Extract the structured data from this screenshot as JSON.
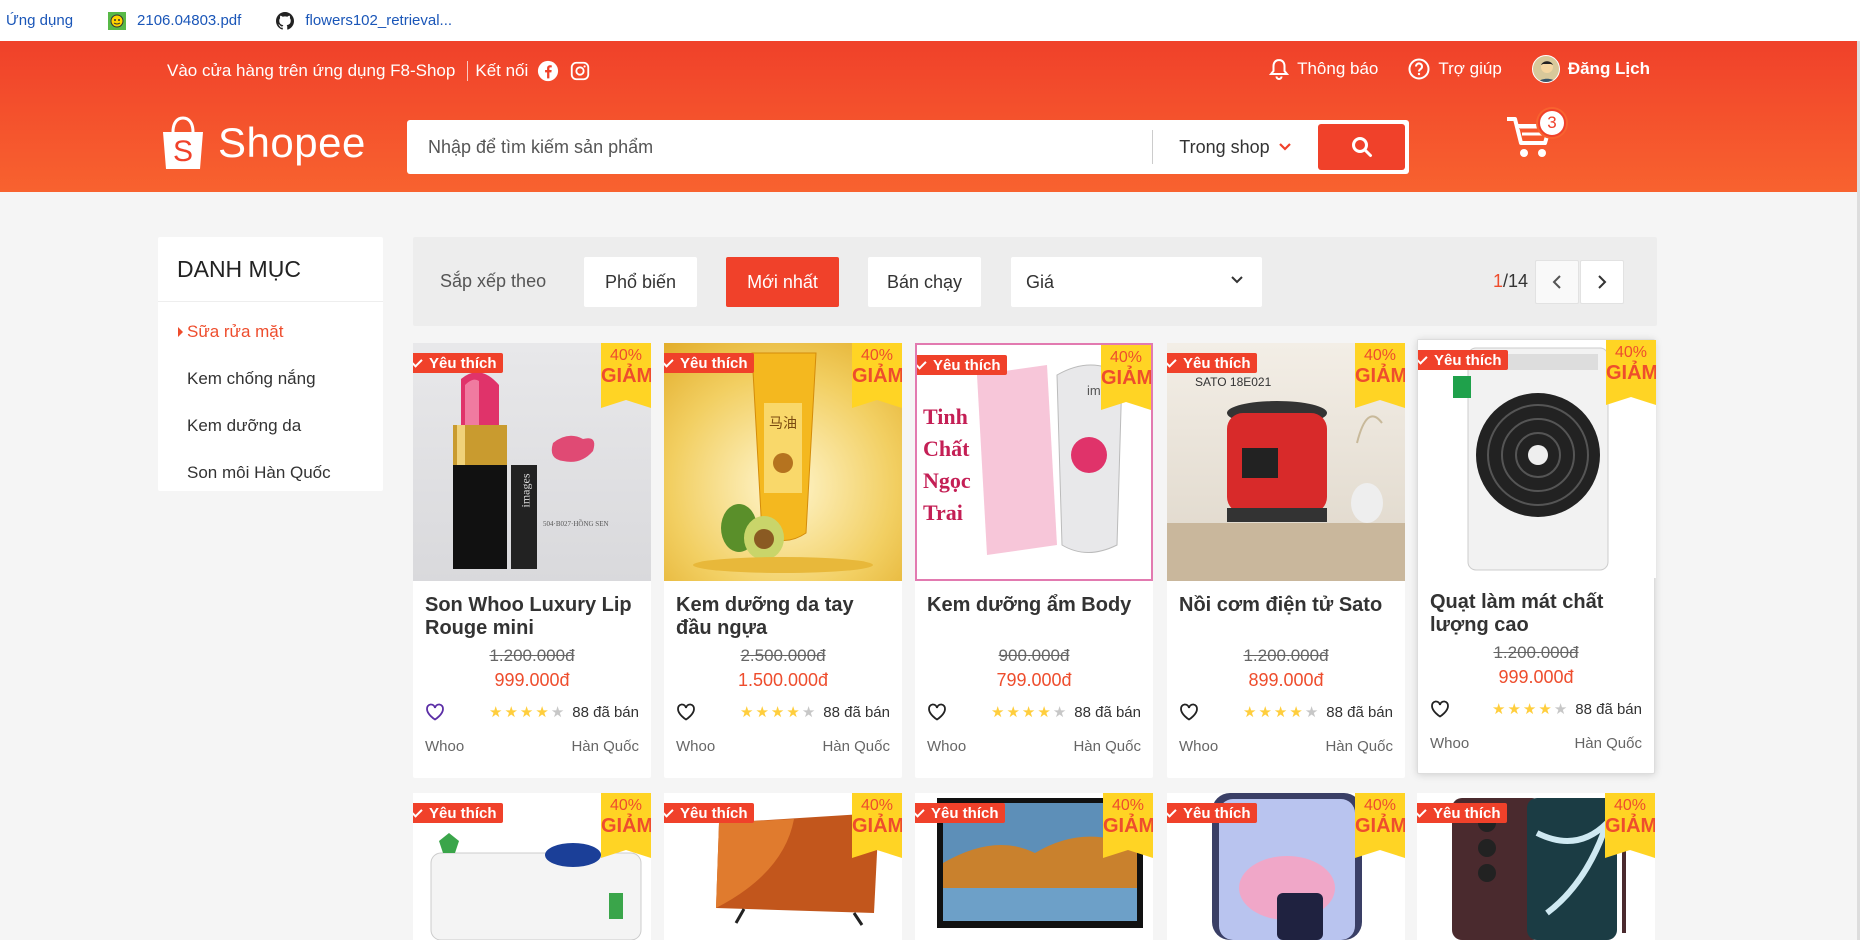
{
  "bookmarks": [
    {
      "label": "Ứng dụng",
      "icon": "apps-icon"
    },
    {
      "label": "2106.04803.pdf",
      "icon": "pdf-favicon-icon"
    },
    {
      "label": "flowers102_retrieval...",
      "icon": "github-icon"
    }
  ],
  "navbar": {
    "app_text": "Vào cửa hàng trên ứng dụng F8-Shop",
    "connect": "Kết nối",
    "notifications": "Thông báo",
    "help": "Trợ giúp",
    "user": "Đăng Lịch"
  },
  "logo": {
    "text": "Shopee"
  },
  "search": {
    "placeholder": "Nhập để tìm kiếm sản phẩm",
    "scope": "Trong shop"
  },
  "cart": {
    "count": "3"
  },
  "category": {
    "heading": "DANH MỤC",
    "items": [
      "Sữa rửa mặt",
      "Kem chống nắng",
      "Kem dưỡng da",
      "Son môi Hàn Quốc"
    ]
  },
  "filter": {
    "label": "Sắp xếp theo",
    "popular": "Phổ biến",
    "newest": "Mới nhất",
    "bestselling": "Bán chạy",
    "price": "Giá",
    "page_current": "1",
    "page_total": "/14"
  },
  "products": [
    {
      "name": "Son Whoo Luxury Lip Rouge mini",
      "old_price": "1.200.000đ",
      "new_price": "999.000đ",
      "rating": 4,
      "sold": "88 đã bán",
      "brand": "Whoo",
      "origin": "Hàn Quốc",
      "badge": "Yêu thích",
      "sale_pct": "40%",
      "sale_label": "GIẢM",
      "liked": true
    },
    {
      "name": "Kem dưỡng da tay đầu ngựa",
      "old_price": "2.500.000đ",
      "new_price": "1.500.000đ",
      "rating": 4,
      "sold": "88 đã bán",
      "brand": "Whoo",
      "origin": "Hàn Quốc",
      "badge": "Yêu thích",
      "sale_pct": "40%",
      "sale_label": "GIẢM",
      "liked": false
    },
    {
      "name": "Kem dưỡng ẩm Body",
      "old_price": "900.000đ",
      "new_price": "799.000đ",
      "rating": 4,
      "sold": "88 đã bán",
      "brand": "Whoo",
      "origin": "Hàn Quốc",
      "badge": "Yêu thích",
      "sale_pct": "40%",
      "sale_label": "GIẢM",
      "liked": false
    },
    {
      "name": "Nồi cơm điện tử Sato",
      "old_price": "1.200.000đ",
      "new_price": "899.000đ",
      "rating": 4,
      "sold": "88 đã bán",
      "brand": "Whoo",
      "origin": "Hàn Quốc",
      "badge": "Yêu thích",
      "sale_pct": "40%",
      "sale_label": "GIẢM",
      "liked": false
    },
    {
      "name": "Quạt làm mát chất lượng cao",
      "old_price": "1.200.000đ",
      "new_price": "999.000đ",
      "rating": 4,
      "sold": "88 đã bán",
      "brand": "Whoo",
      "origin": "Hàn Quốc",
      "badge": "Yêu thích",
      "sale_pct": "40%",
      "sale_label": "GIẢM",
      "liked": false
    },
    {
      "badge": "Yêu thích",
      "sale_pct": "40%",
      "sale_label": "GIẢM"
    },
    {
      "badge": "Yêu thích",
      "sale_pct": "40%",
      "sale_label": "GIẢM"
    },
    {
      "badge": "Yêu thích",
      "sale_pct": "40%",
      "sale_label": "GIẢM"
    },
    {
      "badge": "Yêu thích",
      "sale_pct": "40%",
      "sale_label": "GIẢM"
    },
    {
      "badge": "Yêu thích",
      "sale_pct": "40%",
      "sale_label": "GIẢM"
    }
  ],
  "product_images_text": {
    "lipstick_brand": "images",
    "cream_box": "Tinh Chất Ngọc Trai",
    "rice_cooker_label": "SATO 18E021"
  },
  "colors": {
    "brand": "#ee4d2d",
    "header_top": "#f0412a",
    "sale_badge": "#ffd424",
    "star": "#ffce3d"
  }
}
